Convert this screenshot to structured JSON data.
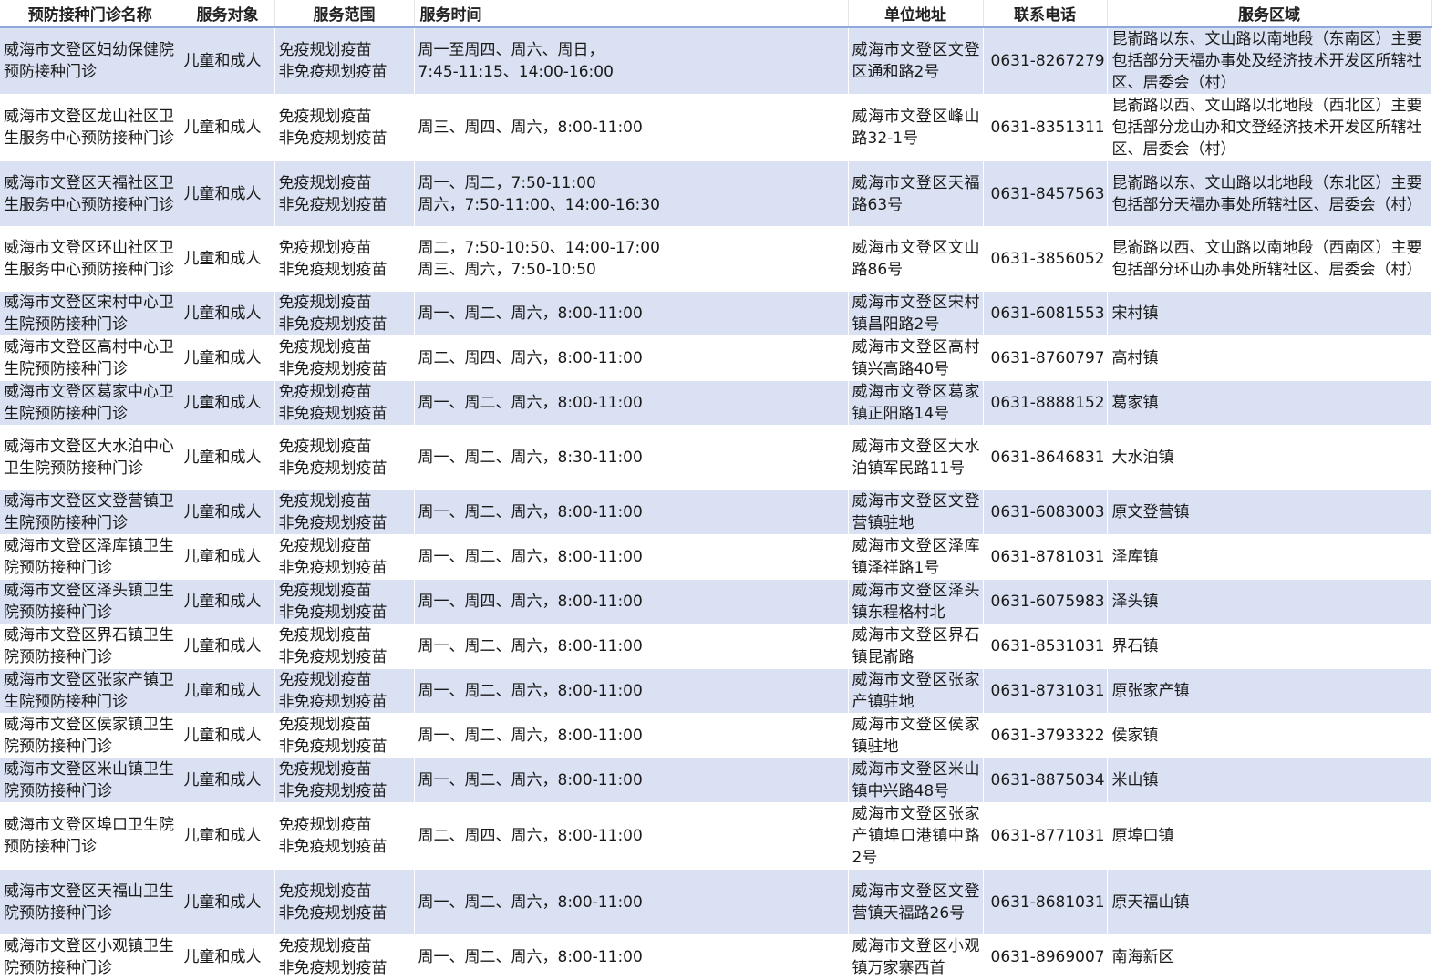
{
  "headers": [
    "预防接种门诊名称",
    "服务对象",
    "服务范围",
    "服务时间",
    "单位地址",
    "联系电话",
    "服务区域"
  ],
  "rows": [
    {
      "name": "威海市文登区妇幼保健院预防接种门诊",
      "target": "儿童和成人",
      "scope": [
        "免疫规划疫苗",
        "非免疫规划疫苗"
      ],
      "time": [
        "周一至周四、周六、周日，",
        "7:45-11:15、14:00-16:00"
      ],
      "address": "威海市文登区文登区通和路2号",
      "phone": "0631-8267279",
      "area": "昆嵛路以东、文山路以南地段（东南区）主要包括部分天福办事处及经济技术开发区所辖社区、居委会（村）"
    },
    {
      "name": "威海市文登区龙山社区卫生服务中心预防接种门诊",
      "target": "儿童和成人",
      "scope": [
        "免疫规划疫苗",
        "非免疫规划疫苗"
      ],
      "time": [
        "周三、周四、周六，8:00-11:00"
      ],
      "address": "威海市文登区峰山路32-1号",
      "phone": "0631-8351311",
      "area": "昆嵛路以西、文山路以北地段（西北区）主要包括部分龙山办和文登经济技术开发区所辖社区、居委会（村）"
    },
    {
      "name": "威海市文登区天福社区卫生服务中心预防接种门诊",
      "target": "儿童和成人",
      "scope": [
        "免疫规划疫苗",
        "非免疫规划疫苗"
      ],
      "time": [
        "周一、周二，7:50-11:00",
        "周六，7:50-11:00、14:00-16:30"
      ],
      "address": "威海市文登区天福路63号",
      "phone": "0631-8457563",
      "area": "昆嵛路以东、文山路以北地段（东北区）主要包括部分天福办事处所辖社区、居委会（村）"
    },
    {
      "name": "威海市文登区环山社区卫生服务中心预防接种门诊",
      "target": "儿童和成人",
      "scope": [
        "免疫规划疫苗",
        "非免疫规划疫苗"
      ],
      "time": [
        "周二，7:50-10:50、14:00-17:00",
        "周三、周六，7:50-10:50"
      ],
      "address": "威海市文登区文山路86号",
      "phone": "0631-3856052",
      "area": "昆嵛路以西、文山路以南地段（西南区）主要包括部分环山办事处所辖社区、居委会（村）"
    },
    {
      "name": "威海市文登区宋村中心卫生院预防接种门诊",
      "target": "儿童和成人",
      "scope": [
        "免疫规划疫苗",
        "非免疫规划疫苗"
      ],
      "time": [
        "周一、周二、周六，8:00-11:00"
      ],
      "address": "威海市文登区宋村镇昌阳路2号",
      "phone": "0631-6081553",
      "area": "宋村镇"
    },
    {
      "name": "威海市文登区高村中心卫生院预防接种门诊",
      "target": "儿童和成人",
      "scope": [
        "免疫规划疫苗",
        "非免疫规划疫苗"
      ],
      "time": [
        "周二、周四、周六，8:00-11:00"
      ],
      "address": "威海市文登区高村镇兴高路40号",
      "phone": "0631-8760797",
      "area": "高村镇"
    },
    {
      "name": "威海市文登区葛家中心卫生院预防接种门诊",
      "target": "儿童和成人",
      "scope": [
        "免疫规划疫苗",
        "非免疫规划疫苗"
      ],
      "time": [
        "周一、周二、周六，8:00-11:00"
      ],
      "address": "威海市文登区葛家镇正阳路14号",
      "phone": "0631-8888152",
      "area": "葛家镇"
    },
    {
      "name": "威海市文登区大水泊中心卫生院预防接种门诊",
      "target": "儿童和成人",
      "scope": [
        "免疫规划疫苗",
        "非免疫规划疫苗"
      ],
      "time": [
        "周一、周二、周六，8:30-11:00"
      ],
      "address": "威海市文登区大水泊镇军民路11号",
      "phone": "0631-8646831",
      "area": "大水泊镇"
    },
    {
      "name": "威海市文登区文登营镇卫生院预防接种门诊",
      "target": "儿童和成人",
      "scope": [
        "免疫规划疫苗",
        "非免疫规划疫苗"
      ],
      "time": [
        "周一、周二、周六，8:00-11:00"
      ],
      "address": "威海市文登区文登营镇驻地",
      "phone": "0631-6083003",
      "area": "原文登营镇"
    },
    {
      "name": "威海市文登区泽库镇卫生院预防接种门诊",
      "target": "儿童和成人",
      "scope": [
        "免疫规划疫苗",
        "非免疫规划疫苗"
      ],
      "time": [
        "周一、周二、周六，8:00-11:00"
      ],
      "address": "威海市文登区泽库镇泽祥路1号",
      "phone": "0631-8781031",
      "area": "泽库镇"
    },
    {
      "name": "威海市文登区泽头镇卫生院预防接种门诊",
      "target": "儿童和成人",
      "scope": [
        "免疫规划疫苗",
        "非免疫规划疫苗"
      ],
      "time": [
        "周一、周四、周六，8:00-11:00"
      ],
      "address": "威海市文登区泽头镇东程格村北",
      "phone": "0631-6075983",
      "area": "泽头镇"
    },
    {
      "name": "威海市文登区界石镇卫生院预防接种门诊",
      "target": "儿童和成人",
      "scope": [
        "免疫规划疫苗",
        "非免疫规划疫苗"
      ],
      "time": [
        "周一、周二、周六，8:00-11:00"
      ],
      "address": "威海市文登区界石镇昆嵛路",
      "phone": "0631-8531031",
      "area": "界石镇"
    },
    {
      "name": "威海市文登区张家产镇卫生院预防接种门诊",
      "target": "儿童和成人",
      "scope": [
        "免疫规划疫苗",
        "非免疫规划疫苗"
      ],
      "time": [
        "周一、周二、周六，8:00-11:00"
      ],
      "address": "威海市文登区张家产镇驻地",
      "phone": "0631-8731031",
      "area": "原张家产镇"
    },
    {
      "name": "威海市文登区侯家镇卫生院预防接种门诊",
      "target": "儿童和成人",
      "scope": [
        "免疫规划疫苗",
        "非免疫规划疫苗"
      ],
      "time": [
        "周一、周二、周六，8:00-11:00"
      ],
      "address": "威海市文登区侯家镇驻地",
      "phone": "0631-3793322",
      "area": "侯家镇"
    },
    {
      "name": "威海市文登区米山镇卫生院预防接种门诊",
      "target": "儿童和成人",
      "scope": [
        "免疫规划疫苗",
        "非免疫规划疫苗"
      ],
      "time": [
        "周一、周二、周六，8:00-11:00"
      ],
      "address": "威海市文登区米山镇中兴路48号",
      "phone": "0631-8875034",
      "area": "米山镇"
    },
    {
      "name": "威海市文登区埠口卫生院预防接种门诊",
      "target": "儿童和成人",
      "scope": [
        "免疫规划疫苗",
        "非免疫规划疫苗"
      ],
      "time": [
        "周二、周四、周六，8:00-11:00"
      ],
      "address": "威海市文登区张家产镇埠口港镇中路2号",
      "phone": "0631-8771031",
      "area": "原埠口镇"
    },
    {
      "name": "威海市文登区天福山卫生院预防接种门诊",
      "target": "儿童和成人",
      "scope": [
        "免疫规划疫苗",
        "非免疫规划疫苗"
      ],
      "time": [
        "周一、周二、周六，8:00-11:00"
      ],
      "address": "威海市文登区文登营镇天福路26号",
      "phone": "0631-8681031",
      "area": "原天福山镇"
    },
    {
      "name": "威海市文登区小观镇卫生院预防接种门诊",
      "target": "儿童和成人",
      "scope": [
        "免疫规划疫苗",
        "非免疫规划疫苗"
      ],
      "time": [
        "周一、周二、周六，8:00-11:00"
      ],
      "address": "威海市文登区小观镇万家寨西首",
      "phone": "0631-8969007",
      "area": "南海新区"
    }
  ]
}
